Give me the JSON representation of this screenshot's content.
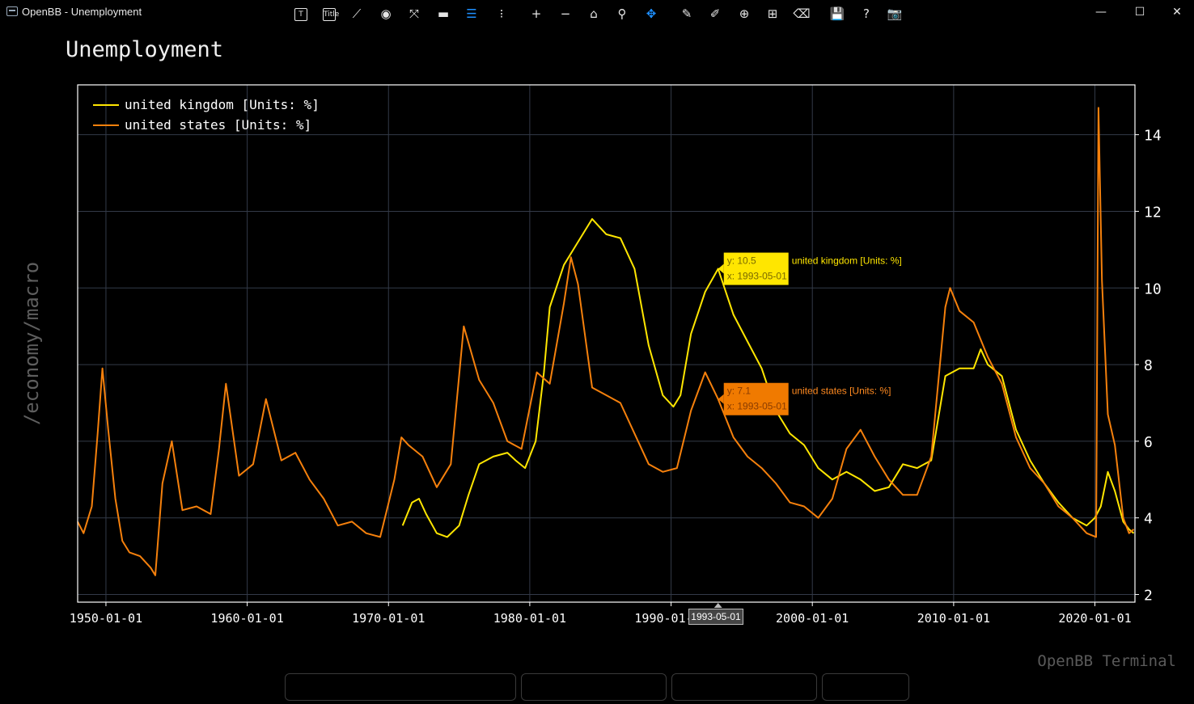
{
  "window": {
    "title": "OpenBB - Unemployment",
    "minimize": "—",
    "maximize": "☐",
    "close": "✕"
  },
  "side_label": "/economy/macro",
  "brand": "OpenBB Terminal",
  "colors": {
    "uk": "#ffe600",
    "us": "#f5800c",
    "grid": "#333a48",
    "axis": "#ffffff"
  },
  "hover": {
    "x_label": "1993-05-01",
    "uk": {
      "y": "y: 10.5",
      "x": "x: 1993-05-01",
      "name": "united kingdom [Units: %]"
    },
    "us": {
      "y": "y: 7.1",
      "x": "x: 1993-05-01",
      "name": "united states [Units: %]"
    }
  },
  "modebar": [
    {
      "name": "text-icon",
      "glyph": "T"
    },
    {
      "name": "title-icon",
      "glyph": "Title"
    },
    {
      "name": "line-chart-icon",
      "glyph": "⟋"
    },
    {
      "name": "circle-target-icon",
      "glyph": "◉"
    },
    {
      "name": "autoscale-icon",
      "glyph": "⤧"
    },
    {
      "name": "tag-icon",
      "glyph": "▬"
    },
    {
      "name": "toggle-lines-icon",
      "glyph": "☰",
      "active": true
    },
    {
      "name": "dots-menu-icon",
      "glyph": "⁝"
    },
    {
      "name": "zoom-in-icon",
      "glyph": "+"
    },
    {
      "name": "zoom-out-icon",
      "glyph": "−"
    },
    {
      "name": "home-icon",
      "glyph": "⌂"
    },
    {
      "name": "zoom-icon",
      "glyph": "⚲"
    },
    {
      "name": "pan-icon",
      "glyph": "✥",
      "active": true
    },
    {
      "name": "draw-line-icon",
      "glyph": "✎"
    },
    {
      "name": "draw-freeform-icon",
      "glyph": "✐"
    },
    {
      "name": "draw-circle-icon",
      "glyph": "⊕"
    },
    {
      "name": "draw-rect-icon",
      "glyph": "⊞"
    },
    {
      "name": "erase-shape-icon",
      "glyph": "⌫"
    },
    {
      "name": "save-icon",
      "glyph": "💾"
    },
    {
      "name": "help-icon",
      "glyph": "?"
    },
    {
      "name": "camera-icon",
      "glyph": "📷"
    }
  ],
  "chart_data": {
    "type": "line",
    "title": "Unemployment",
    "xlabel": "",
    "ylabel": "",
    "x_tick_labels": [
      "1950-01-01",
      "1960-01-01",
      "1970-01-01",
      "1980-01-01",
      "1990-01-01",
      "2000-01-01",
      "2010-01-01",
      "2020-01-01"
    ],
    "y_ticks": [
      2,
      4,
      6,
      8,
      10,
      12,
      14
    ],
    "xlim": [
      "1948-01-01",
      "2022-11-01"
    ],
    "ylim": [
      1.8,
      15.3
    ],
    "y_axis_side": "right",
    "grid": true,
    "legend_position": "top-left",
    "series": [
      {
        "name": "united kingdom [Units: %]",
        "color": "#ffe600",
        "points": [
          [
            "1971-01-01",
            3.8
          ],
          [
            "1971-09-01",
            4.4
          ],
          [
            "1972-03-01",
            4.5
          ],
          [
            "1972-09-01",
            4.1
          ],
          [
            "1973-06-01",
            3.6
          ],
          [
            "1974-03-01",
            3.5
          ],
          [
            "1975-01-01",
            3.8
          ],
          [
            "1975-09-01",
            4.6
          ],
          [
            "1976-06-01",
            5.4
          ],
          [
            "1977-06-01",
            5.6
          ],
          [
            "1978-06-01",
            5.7
          ],
          [
            "1979-01-01",
            5.5
          ],
          [
            "1979-09-01",
            5.3
          ],
          [
            "1980-06-01",
            6.0
          ],
          [
            "1981-01-01",
            7.8
          ],
          [
            "1981-06-01",
            9.5
          ],
          [
            "1982-06-01",
            10.6
          ],
          [
            "1983-06-01",
            11.2
          ],
          [
            "1984-06-01",
            11.8
          ],
          [
            "1985-06-01",
            11.4
          ],
          [
            "1986-06-01",
            11.3
          ],
          [
            "1987-06-01",
            10.5
          ],
          [
            "1988-06-01",
            8.5
          ],
          [
            "1989-06-01",
            7.2
          ],
          [
            "1990-03-01",
            6.9
          ],
          [
            "1990-09-01",
            7.2
          ],
          [
            "1991-06-01",
            8.8
          ],
          [
            "1992-06-01",
            9.9
          ],
          [
            "1993-05-01",
            10.5
          ],
          [
            "1994-06-01",
            9.3
          ],
          [
            "1995-06-01",
            8.6
          ],
          [
            "1996-06-01",
            7.9
          ],
          [
            "1997-06-01",
            6.8
          ],
          [
            "1998-06-01",
            6.2
          ],
          [
            "1999-06-01",
            5.9
          ],
          [
            "2000-06-01",
            5.3
          ],
          [
            "2001-06-01",
            5.0
          ],
          [
            "2002-06-01",
            5.2
          ],
          [
            "2003-06-01",
            5.0
          ],
          [
            "2004-06-01",
            4.7
          ],
          [
            "2005-06-01",
            4.8
          ],
          [
            "2006-06-01",
            5.4
          ],
          [
            "2007-06-01",
            5.3
          ],
          [
            "2008-06-01",
            5.5
          ],
          [
            "2009-06-01",
            7.7
          ],
          [
            "2010-06-01",
            7.9
          ],
          [
            "2011-06-01",
            7.9
          ],
          [
            "2011-12-01",
            8.4
          ],
          [
            "2012-06-01",
            8.0
          ],
          [
            "2013-06-01",
            7.7
          ],
          [
            "2014-06-01",
            6.3
          ],
          [
            "2015-06-01",
            5.5
          ],
          [
            "2016-06-01",
            4.9
          ],
          [
            "2017-06-01",
            4.4
          ],
          [
            "2018-06-01",
            4.0
          ],
          [
            "2019-06-01",
            3.8
          ],
          [
            "2020-01-01",
            4.0
          ],
          [
            "2020-06-01",
            4.3
          ],
          [
            "2020-12-01",
            5.2
          ],
          [
            "2021-06-01",
            4.7
          ],
          [
            "2022-01-01",
            3.9
          ],
          [
            "2022-06-01",
            3.7
          ],
          [
            "2022-10-01",
            3.6
          ]
        ]
      },
      {
        "name": "united states [Units: %]",
        "color": "#f5800c",
        "points": [
          [
            "1948-01-01",
            3.9
          ],
          [
            "1948-06-01",
            3.6
          ],
          [
            "1949-01-01",
            4.3
          ],
          [
            "1949-06-01",
            6.2
          ],
          [
            "1949-10-01",
            7.9
          ],
          [
            "1950-03-01",
            6.3
          ],
          [
            "1950-09-01",
            4.5
          ],
          [
            "1951-03-01",
            3.4
          ],
          [
            "1951-09-01",
            3.1
          ],
          [
            "1952-06-01",
            3.0
          ],
          [
            "1953-03-01",
            2.7
          ],
          [
            "1953-07-01",
            2.5
          ],
          [
            "1954-01-01",
            4.9
          ],
          [
            "1954-09-01",
            6.0
          ],
          [
            "1955-06-01",
            4.2
          ],
          [
            "1956-06-01",
            4.3
          ],
          [
            "1957-06-01",
            4.1
          ],
          [
            "1958-01-01",
            5.8
          ],
          [
            "1958-07-01",
            7.5
          ],
          [
            "1959-06-01",
            5.1
          ],
          [
            "1960-06-01",
            5.4
          ],
          [
            "1961-05-01",
            7.1
          ],
          [
            "1962-06-01",
            5.5
          ],
          [
            "1963-06-01",
            5.7
          ],
          [
            "1964-06-01",
            5.0
          ],
          [
            "1965-06-01",
            4.5
          ],
          [
            "1966-06-01",
            3.8
          ],
          [
            "1967-06-01",
            3.9
          ],
          [
            "1968-06-01",
            3.6
          ],
          [
            "1969-06-01",
            3.5
          ],
          [
            "1970-06-01",
            5.0
          ],
          [
            "1970-12-01",
            6.1
          ],
          [
            "1971-06-01",
            5.9
          ],
          [
            "1972-06-01",
            5.6
          ],
          [
            "1973-06-01",
            4.8
          ],
          [
            "1974-06-01",
            5.4
          ],
          [
            "1975-05-01",
            9.0
          ],
          [
            "1976-06-01",
            7.6
          ],
          [
            "1977-06-01",
            7.0
          ],
          [
            "1978-06-01",
            6.0
          ],
          [
            "1979-06-01",
            5.8
          ],
          [
            "1980-07-01",
            7.8
          ],
          [
            "1981-06-01",
            7.5
          ],
          [
            "1982-06-01",
            9.6
          ],
          [
            "1982-12-01",
            10.8
          ],
          [
            "1983-06-01",
            10.1
          ],
          [
            "1984-06-01",
            7.4
          ],
          [
            "1985-06-01",
            7.2
          ],
          [
            "1986-06-01",
            7.0
          ],
          [
            "1987-06-01",
            6.2
          ],
          [
            "1988-06-01",
            5.4
          ],
          [
            "1989-06-01",
            5.2
          ],
          [
            "1990-06-01",
            5.3
          ],
          [
            "1991-06-01",
            6.8
          ],
          [
            "1992-06-01",
            7.8
          ],
          [
            "1993-05-01",
            7.1
          ],
          [
            "1994-06-01",
            6.1
          ],
          [
            "1995-06-01",
            5.6
          ],
          [
            "1996-06-01",
            5.3
          ],
          [
            "1997-06-01",
            4.9
          ],
          [
            "1998-06-01",
            4.4
          ],
          [
            "1999-06-01",
            4.3
          ],
          [
            "2000-06-01",
            4.0
          ],
          [
            "2001-06-01",
            4.5
          ],
          [
            "2002-06-01",
            5.8
          ],
          [
            "2003-06-01",
            6.3
          ],
          [
            "2004-06-01",
            5.6
          ],
          [
            "2005-06-01",
            5.0
          ],
          [
            "2006-06-01",
            4.6
          ],
          [
            "2007-06-01",
            4.6
          ],
          [
            "2008-06-01",
            5.6
          ],
          [
            "2009-06-01",
            9.5
          ],
          [
            "2009-10-01",
            10.0
          ],
          [
            "2010-06-01",
            9.4
          ],
          [
            "2011-06-01",
            9.1
          ],
          [
            "2012-06-01",
            8.2
          ],
          [
            "2013-06-01",
            7.5
          ],
          [
            "2014-06-01",
            6.1
          ],
          [
            "2015-06-01",
            5.3
          ],
          [
            "2016-06-01",
            4.9
          ],
          [
            "2017-06-01",
            4.3
          ],
          [
            "2018-06-01",
            4.0
          ],
          [
            "2019-06-01",
            3.6
          ],
          [
            "2020-02-01",
            3.5
          ],
          [
            "2020-04-01",
            14.7
          ],
          [
            "2020-07-01",
            10.2
          ],
          [
            "2020-12-01",
            6.7
          ],
          [
            "2021-06-01",
            5.9
          ],
          [
            "2022-01-01",
            4.0
          ],
          [
            "2022-06-01",
            3.6
          ],
          [
            "2022-10-01",
            3.7
          ]
        ]
      }
    ],
    "hover_date": "1993-05-01"
  }
}
